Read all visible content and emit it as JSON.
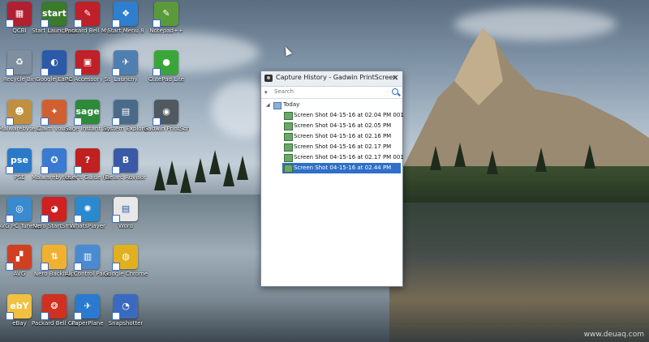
{
  "desktop": {
    "icons": [
      {
        "label": "QCBI",
        "color": "#b02030",
        "glyph": "▦"
      },
      {
        "label": "Start Launchpad",
        "color": "#3a7a2a",
        "glyph": "start"
      },
      {
        "label": "Packard Bell MyCamEdit",
        "color": "#c0202a",
        "glyph": "✎"
      },
      {
        "label": "Start Menu 8",
        "color": "#2f7fd0",
        "glyph": "❖"
      },
      {
        "label": "Notepad++",
        "color": "#5a9a3a",
        "glyph": "✎"
      },
      {
        "label": "Recycle Bin",
        "color": "#7f8f9f",
        "glyph": "♻"
      },
      {
        "label": "Google Earth",
        "color": "#2a5aa8",
        "glyph": "◐"
      },
      {
        "label": "PC Accessory Store",
        "color": "#c02028",
        "glyph": "▣"
      },
      {
        "label": "Launchy",
        "color": "#4f7fb0",
        "glyph": "✈"
      },
      {
        "label": "CutePad Lite",
        "color": "#3aa63a",
        "glyph": "●"
      },
      {
        "label": "Malwarebyte...",
        "color": "#c09040",
        "glyph": "☻"
      },
      {
        "label": "Claim your...",
        "color": "#d06030",
        "glyph": "✦"
      },
      {
        "label": "Sage Instant Accounts",
        "color": "#2e8a3a",
        "glyph": "sage"
      },
      {
        "label": "System Explorer",
        "color": "#4a6a8a",
        "glyph": "▤"
      },
      {
        "label": "Gadwin PrintScreen",
        "color": "#505860",
        "glyph": "◉"
      },
      {
        "label": "PSE",
        "color": "#2a7ac8",
        "glyph": "pse"
      },
      {
        "label": "Malwarebytes Anti-Malware",
        "color": "#3a7ad0",
        "glyph": "✪"
      },
      {
        "label": "User's Guide (Packard B...",
        "color": "#c02020",
        "glyph": "?"
      },
      {
        "label": "Belarc Advisor",
        "color": "#3a5aa8",
        "glyph": "B"
      },
      {
        "label": "AVG PC TuneUp",
        "color": "#3a8ad0",
        "glyph": "◎"
      },
      {
        "label": "Nero StartSm...",
        "color": "#d02020",
        "glyph": "◕"
      },
      {
        "label": "WhatsPlayer",
        "color": "#2a8ad0",
        "glyph": "✺"
      },
      {
        "label": "Word",
        "color": "#e8e8e8",
        "glyph": "▤"
      },
      {
        "label": "AVG",
        "color": "#d04020",
        "glyph": "▞"
      },
      {
        "label": "Nero BackItUp",
        "color": "#f0b030",
        "glyph": "⇅"
      },
      {
        "label": "All Control Panel Items",
        "color": "#4a8ad0",
        "glyph": "▥"
      },
      {
        "label": "Google Chrome",
        "color": "#e0b020",
        "glyph": "◍"
      },
      {
        "label": "eBay",
        "color": "#f0c040",
        "glyph": "ebY"
      },
      {
        "label": "Packard Bell Games",
        "color": "#d03020",
        "glyph": "❂"
      },
      {
        "label": "PaperPlane",
        "color": "#2a7ad0",
        "glyph": "✈"
      },
      {
        "label": "Snapshotter",
        "color": "#3a6ac0",
        "glyph": "◔"
      }
    ]
  },
  "window": {
    "title": "Capture History - Gadwin PrintScreen",
    "close_glyph": "×",
    "search_placeholder": "Search",
    "dropdown_glyph": "▾",
    "tree_group": "Today",
    "expander_glyph": "◢",
    "items": [
      {
        "label": "Screen Shot 04-15-16 at 02.04 PM 001",
        "selected": false
      },
      {
        "label": "Screen Shot 04-15-16 at 02.05 PM",
        "selected": false
      },
      {
        "label": "Screen Shot 04-15-16 at 02.16 PM",
        "selected": false
      },
      {
        "label": "Screen Shot 04-15-16 at 02.17 PM",
        "selected": false
      },
      {
        "label": "Screen Shot 04-15-16 at 02.17 PM 001",
        "selected": false
      },
      {
        "label": "Screen Shot 04-15-16 at 02.44 PM",
        "selected": true
      }
    ]
  },
  "watermark": "www.deuaq.com"
}
